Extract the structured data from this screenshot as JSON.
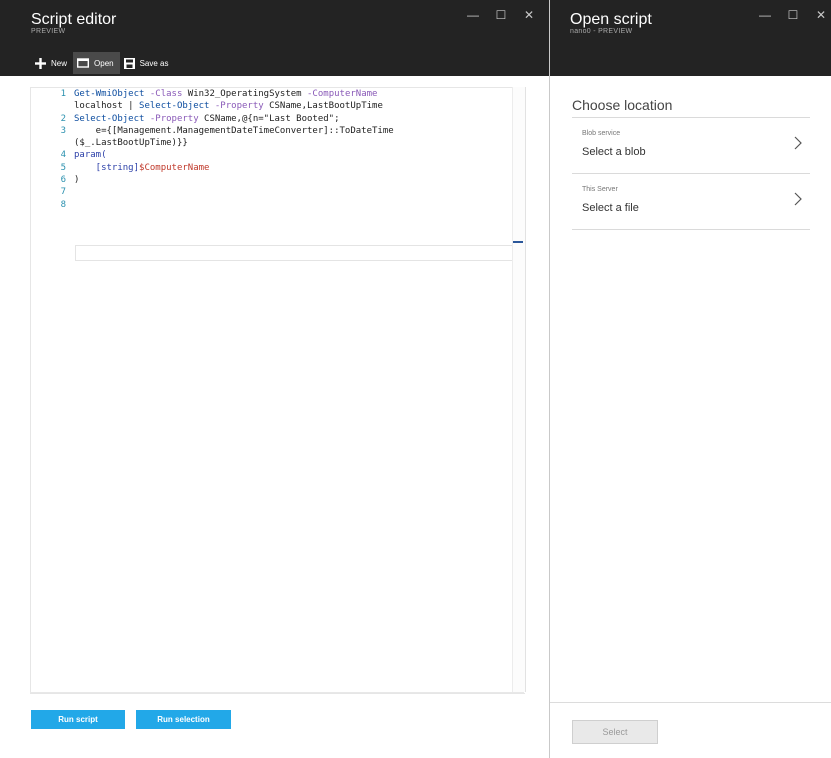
{
  "editor_blade": {
    "title": "Script editor",
    "subtitle": "PREVIEW",
    "window_controls": [
      "—",
      "☐",
      "✕"
    ],
    "toolbar": {
      "new_label": "New",
      "open_label": "Open",
      "save_as_label": "Save as"
    },
    "code_lines": [
      {
        "num": "1",
        "segments": [
          {
            "t": "Get-WmiObject ",
            "c": "cmd"
          },
          {
            "t": "-Class ",
            "c": "param"
          },
          {
            "t": "Win32_OperatingSystem ",
            "c": "txt"
          },
          {
            "t": "-ComputerName",
            "c": "param"
          }
        ]
      },
      {
        "num": "",
        "segments": [
          {
            "t": "localhost | ",
            "c": "txt"
          },
          {
            "t": "Select-Object ",
            "c": "cmd"
          },
          {
            "t": "-Property ",
            "c": "param"
          },
          {
            "t": "CSName,LastBootUpTime",
            "c": "txt"
          }
        ]
      },
      {
        "num": "2",
        "segments": [
          {
            "t": "Select-Object ",
            "c": "cmd"
          },
          {
            "t": "-Property ",
            "c": "param"
          },
          {
            "t": "CSName,@{n=\"Last Booted\";",
            "c": "txt"
          }
        ]
      },
      {
        "num": "3",
        "segments": [
          {
            "t": "    e={[Management.ManagementDateTimeConverter]::ToDateTime",
            "c": "txt"
          }
        ]
      },
      {
        "num": "",
        "segments": [
          {
            "t": "($_.LastBootUpTime)}}",
            "c": "txt"
          }
        ]
      },
      {
        "num": "4",
        "segments": [
          {
            "t": "param(",
            "c": "kw"
          }
        ]
      },
      {
        "num": "5",
        "segments": [
          {
            "t": "    [string]",
            "c": "typ"
          },
          {
            "t": "$ComputerName",
            "c": "var"
          }
        ]
      },
      {
        "num": "6",
        "segments": [
          {
            "t": ")",
            "c": "txt"
          }
        ]
      },
      {
        "num": "7",
        "segments": []
      },
      {
        "num": "8",
        "segments": []
      }
    ],
    "run_script_label": "Run script",
    "run_selection_label": "Run selection"
  },
  "open_blade": {
    "title": "Open script",
    "subtitle": "nano0 - PREVIEW",
    "window_controls": [
      "—",
      "☐",
      "✕"
    ],
    "choose_heading": "Choose location",
    "locations": [
      {
        "small": "Blob service",
        "main": "Select a blob"
      },
      {
        "small": "This Server",
        "main": "Select a file"
      }
    ],
    "select_label": "Select"
  },
  "colors": {
    "header_bg": "#232323",
    "accent_blue": "#22a8e8",
    "cmdlet": "#0e4ea0",
    "parameter": "#8a5ab8",
    "variable": "#c0392b",
    "line_number": "#2b91af"
  }
}
